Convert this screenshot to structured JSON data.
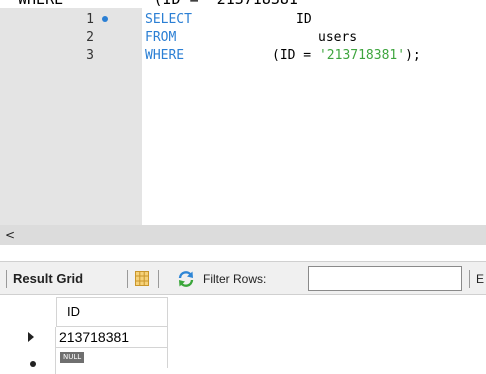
{
  "top_strip": {
    "text": "WHERE          (ID = '213718381'"
  },
  "editor": {
    "lines": [
      {
        "num": "1",
        "keyword": "SELECT",
        "rest": "ID"
      },
      {
        "num": "2",
        "keyword": "FROM",
        "rest": "users"
      },
      {
        "num": "3",
        "keyword": "WHERE",
        "rest_pre": "(ID = ",
        "string": "'213718381'",
        "rest_post": ");"
      }
    ]
  },
  "scrollbar": {
    "left_arrow": "<"
  },
  "toolbar": {
    "result_grid_label": "Result Grid",
    "filter_label": "Filter Rows:",
    "filter_value": "",
    "edit_label": "E"
  },
  "grid": {
    "columns": [
      "ID"
    ],
    "rows": [
      [
        "213718381"
      ]
    ],
    "null_label": "NULL"
  },
  "colors": {
    "keyword": "#2b7fd4",
    "string": "#3fa53f",
    "gutter": "#e4e4e4",
    "marker": "#2b7fd4"
  },
  "icons": {
    "marker": "breakpoint-dot-icon",
    "grid": "grid-layout-icon",
    "refresh": "refresh-icon",
    "row_current": "current-row-arrow-icon",
    "row_new": "new-row-star-icon"
  }
}
